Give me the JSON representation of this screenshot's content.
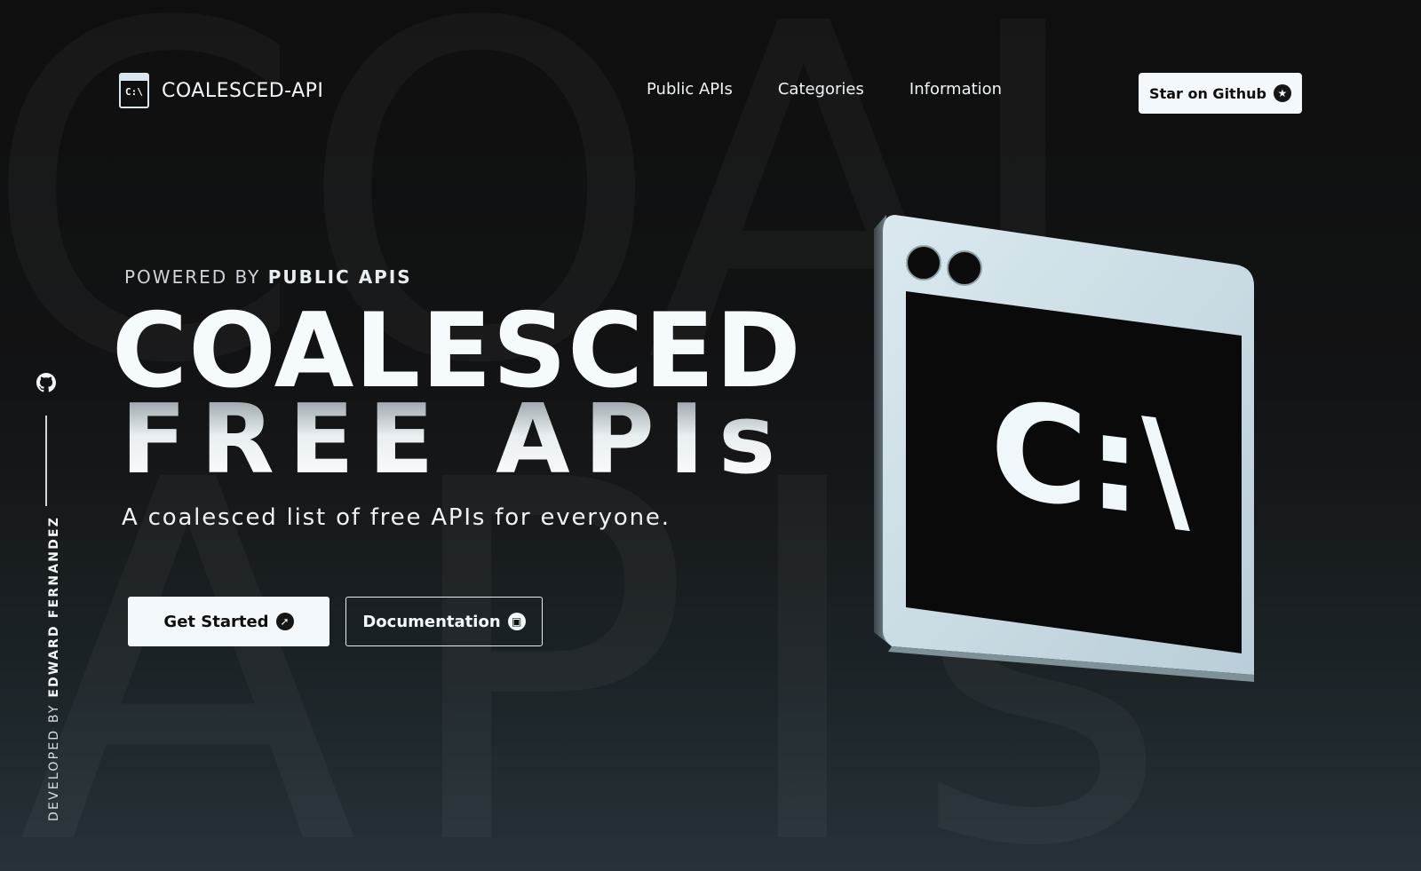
{
  "background": {
    "row1": "COAL",
    "row2": "APIs"
  },
  "header": {
    "logo_icon_text": "C:\\",
    "logo_text": "COALESCED-API",
    "nav": [
      "Public APIs",
      "Categories",
      "Information"
    ],
    "star_button": "Star on Github"
  },
  "side": {
    "developed_by_prefix": "DEVELOPED BY ",
    "developer_name": "EDWARD FERNANDEZ"
  },
  "hero": {
    "powered_prefix": "POWERED BY ",
    "powered_name": "PUBLIC APIS",
    "title_line1": "COALESCED",
    "title_line2": "FREE APIs",
    "subtitle": "A coalesced list of free APIs for everyone.",
    "primary_button": "Get Started",
    "secondary_button": "Documentation"
  },
  "illustration": {
    "screen_text": "C:\\"
  },
  "colors": {
    "background": "#0f0f0f",
    "accent": "#f2f8fb",
    "window_frame": "#cfe0e8"
  },
  "icons": {
    "star_button": "star-icon",
    "primary_button": "rocket-icon",
    "secondary_button": "book-icon",
    "side": "github-icon"
  }
}
